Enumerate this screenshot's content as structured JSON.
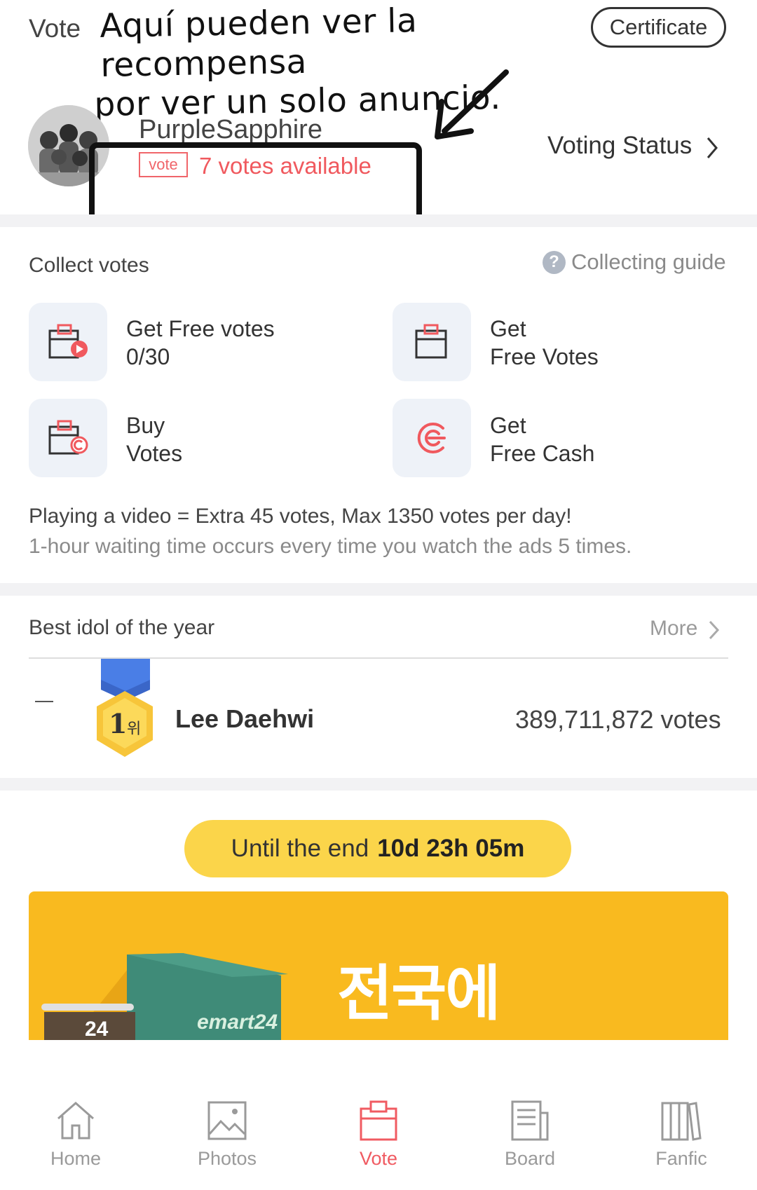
{
  "header": {
    "title": "Vote",
    "annotation_line1": "Aquí pueden ver la recompensa",
    "annotation_line2": "por ver un solo anuncio.",
    "certificate_label": "Certificate"
  },
  "profile": {
    "username": "PurpleSapphire",
    "badge": "vote",
    "votes_available": "7 votes available",
    "voting_status_label": "Voting Status"
  },
  "collect": {
    "title": "Collect votes",
    "guide_label": "Collecting guide",
    "tiles": [
      {
        "label": "Get Free votes\n0/30",
        "icon": "video-vote-icon"
      },
      {
        "label": "Get\nFree Votes",
        "icon": "ballot-box-icon"
      },
      {
        "label": "Buy\nVotes",
        "icon": "buy-vote-icon"
      },
      {
        "label": "Get\nFree Cash",
        "icon": "cash-icon"
      }
    ],
    "info_line1": "Playing a video = Extra 45 votes, Max 1350 votes per day!",
    "info_line2": "1-hour waiting time occurs every time you watch the ads 5 times."
  },
  "ranking": {
    "title": "Best idol of the year",
    "more_label": "More",
    "rank_number": "1",
    "rank_suffix": "위",
    "idol_name": "Lee Daehwi",
    "idol_votes": "389,711,872 votes"
  },
  "countdown": {
    "prefix": "Until the end",
    "time": "10d 23h 05m"
  },
  "banner": {
    "text": "전국에",
    "store_label": "emart24",
    "sign_text": "24"
  },
  "nav": {
    "items": [
      {
        "label": "Home",
        "icon": "home-icon"
      },
      {
        "label": "Photos",
        "icon": "photos-icon"
      },
      {
        "label": "Vote",
        "icon": "vote-icon",
        "active": true
      },
      {
        "label": "Board",
        "icon": "board-icon"
      },
      {
        "label": "Fanfic",
        "icon": "fanfic-icon"
      }
    ]
  },
  "colors": {
    "accent_red": "#f05b62",
    "countdown_yellow": "#fbd54a",
    "banner_orange": "#f9ba1f",
    "tile_bg": "#eef2f8"
  }
}
